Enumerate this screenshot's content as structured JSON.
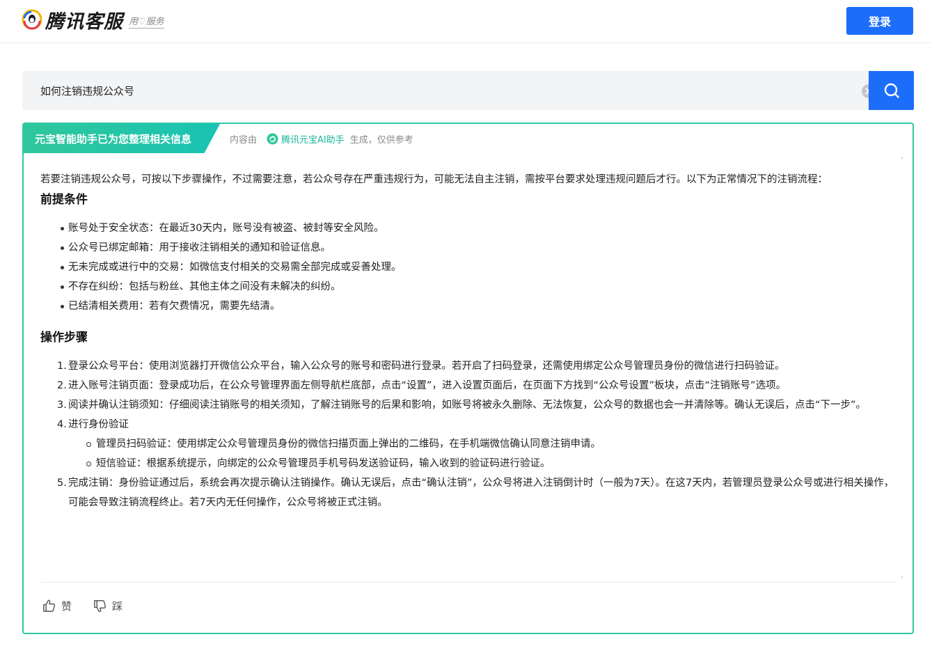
{
  "header": {
    "brand": "腾讯客服",
    "slogan": "用♡服务",
    "login_label": "登录"
  },
  "search": {
    "query": "如何注销违规公众号"
  },
  "ai_card": {
    "tab_title": "元宝智能助手已为您整理相关信息",
    "meta_prefix": "内容由",
    "meta_brand": "腾讯元宝AI助手",
    "meta_suffix": "生成，仅供参考",
    "intro": "若要注销违规公众号，可按以下步骤操作，不过需要注意，若公众号存在严重违规行为，可能无法自主注销，需按平台要求处理违规问题后才行。以下为正常情况下的注销流程：",
    "section1_title": "前提条件",
    "prerequisites": [
      "账号处于安全状态：在最近30天内，账号没有被盗、被封等安全风险。",
      "公众号已绑定邮箱：用于接收注销相关的通知和验证信息。",
      "无未完成或进行中的交易：如微信支付相关的交易需全部完成或妥善处理。",
      "不存在纠纷：包括与粉丝、其他主体之间没有未解决的纠纷。",
      "已结清相关费用：若有欠费情况，需要先结清。"
    ],
    "section2_title": "操作步骤",
    "steps": [
      {
        "num": "1.",
        "text": "登录公众号平台：使用浏览器打开微信公众平台，输入公众号的账号和密码进行登录。若开启了扫码登录，还需使用绑定公众号管理员身份的微信进行扫码验证。"
      },
      {
        "num": "2.",
        "text": "进入账号注销页面：登录成功后，在公众号管理界面左侧导航栏底部，点击“设置”，进入设置页面后，在页面下方找到“公众号设置”板块，点击“注销账号”选项。"
      },
      {
        "num": "3.",
        "text": "阅读并确认注销须知：仔细阅读注销账号的相关须知，了解注销账号的后果和影响，如账号将被永久删除、无法恢复，公众号的数据也会一并清除等。确认无误后，点击“下一步”。"
      },
      {
        "num": "4.",
        "text": "进行身份验证"
      },
      {
        "num": "5.",
        "text": "完成注销：身份验证通过后，系统会再次提示确认注销操作。确认无误后，点击“确认注销”，公众号将进入注销倒计时（一般为7天）。在这7天内，若管理员登录公众号或进行相关操作，可能会导致注销流程终止。若7天内无任何操作，公众号将被正式注销。"
      }
    ],
    "step4_sub": [
      "管理员扫码验证：使用绑定公众号管理员身份的微信扫描页面上弹出的二维码，在手机端微信确认同意注销申请。",
      "短信验证：根据系统提示，向绑定的公众号管理员手机号码发送验证码，输入收到的验证码进行验证。"
    ],
    "like_label": "赞",
    "dislike_label": "踩"
  },
  "colors": {
    "primary": "#1c6dfa",
    "accent_green": "#2fc8a4"
  }
}
